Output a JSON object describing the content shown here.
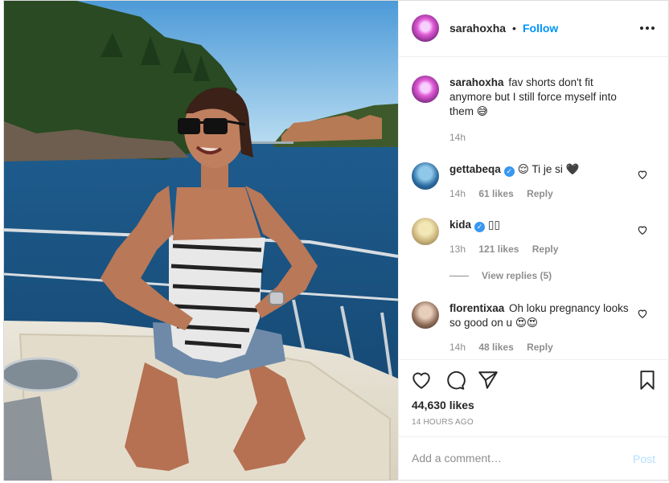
{
  "post": {
    "photo_alt": "photo",
    "owner": {
      "username": "sarahoxha",
      "separator": "•",
      "follow_label": "Follow"
    },
    "caption": {
      "username": "sarahoxha",
      "text": "fav shorts don't fit anymore but I still force myself into them 😅",
      "time": "14h"
    },
    "comments": [
      {
        "username": "gettabeqa",
        "verified": true,
        "text": "😌 Ti je si 🖤",
        "time": "14h",
        "likes": "61 likes",
        "reply": "Reply"
      },
      {
        "username": "kida",
        "verified": true,
        "text": "▯▯",
        "time": "13h",
        "likes": "121 likes",
        "reply": "Reply"
      },
      {
        "username": "florentixaa",
        "verified": false,
        "text": "Oh loku pregnancy looks so good on u 😍😍",
        "time": "14h",
        "likes": "48 likes",
        "reply": "Reply"
      }
    ],
    "view_replies": "View replies (5)",
    "likes_total": "44,630 likes",
    "time_ago": "14 HOURS AGO",
    "add_comment": {
      "placeholder": "Add a comment…",
      "post_label": "Post"
    },
    "icons": {
      "more": "more-options-icon",
      "like": "heart-icon",
      "comment": "comment-icon",
      "share": "share-icon",
      "save": "bookmark-icon",
      "verified": "verified-badge-icon"
    },
    "colors": {
      "accent": "#0095f6",
      "verified": "#3897f0",
      "post_disabled": "#b2dffc",
      "muted": "#8e8e8e"
    }
  }
}
